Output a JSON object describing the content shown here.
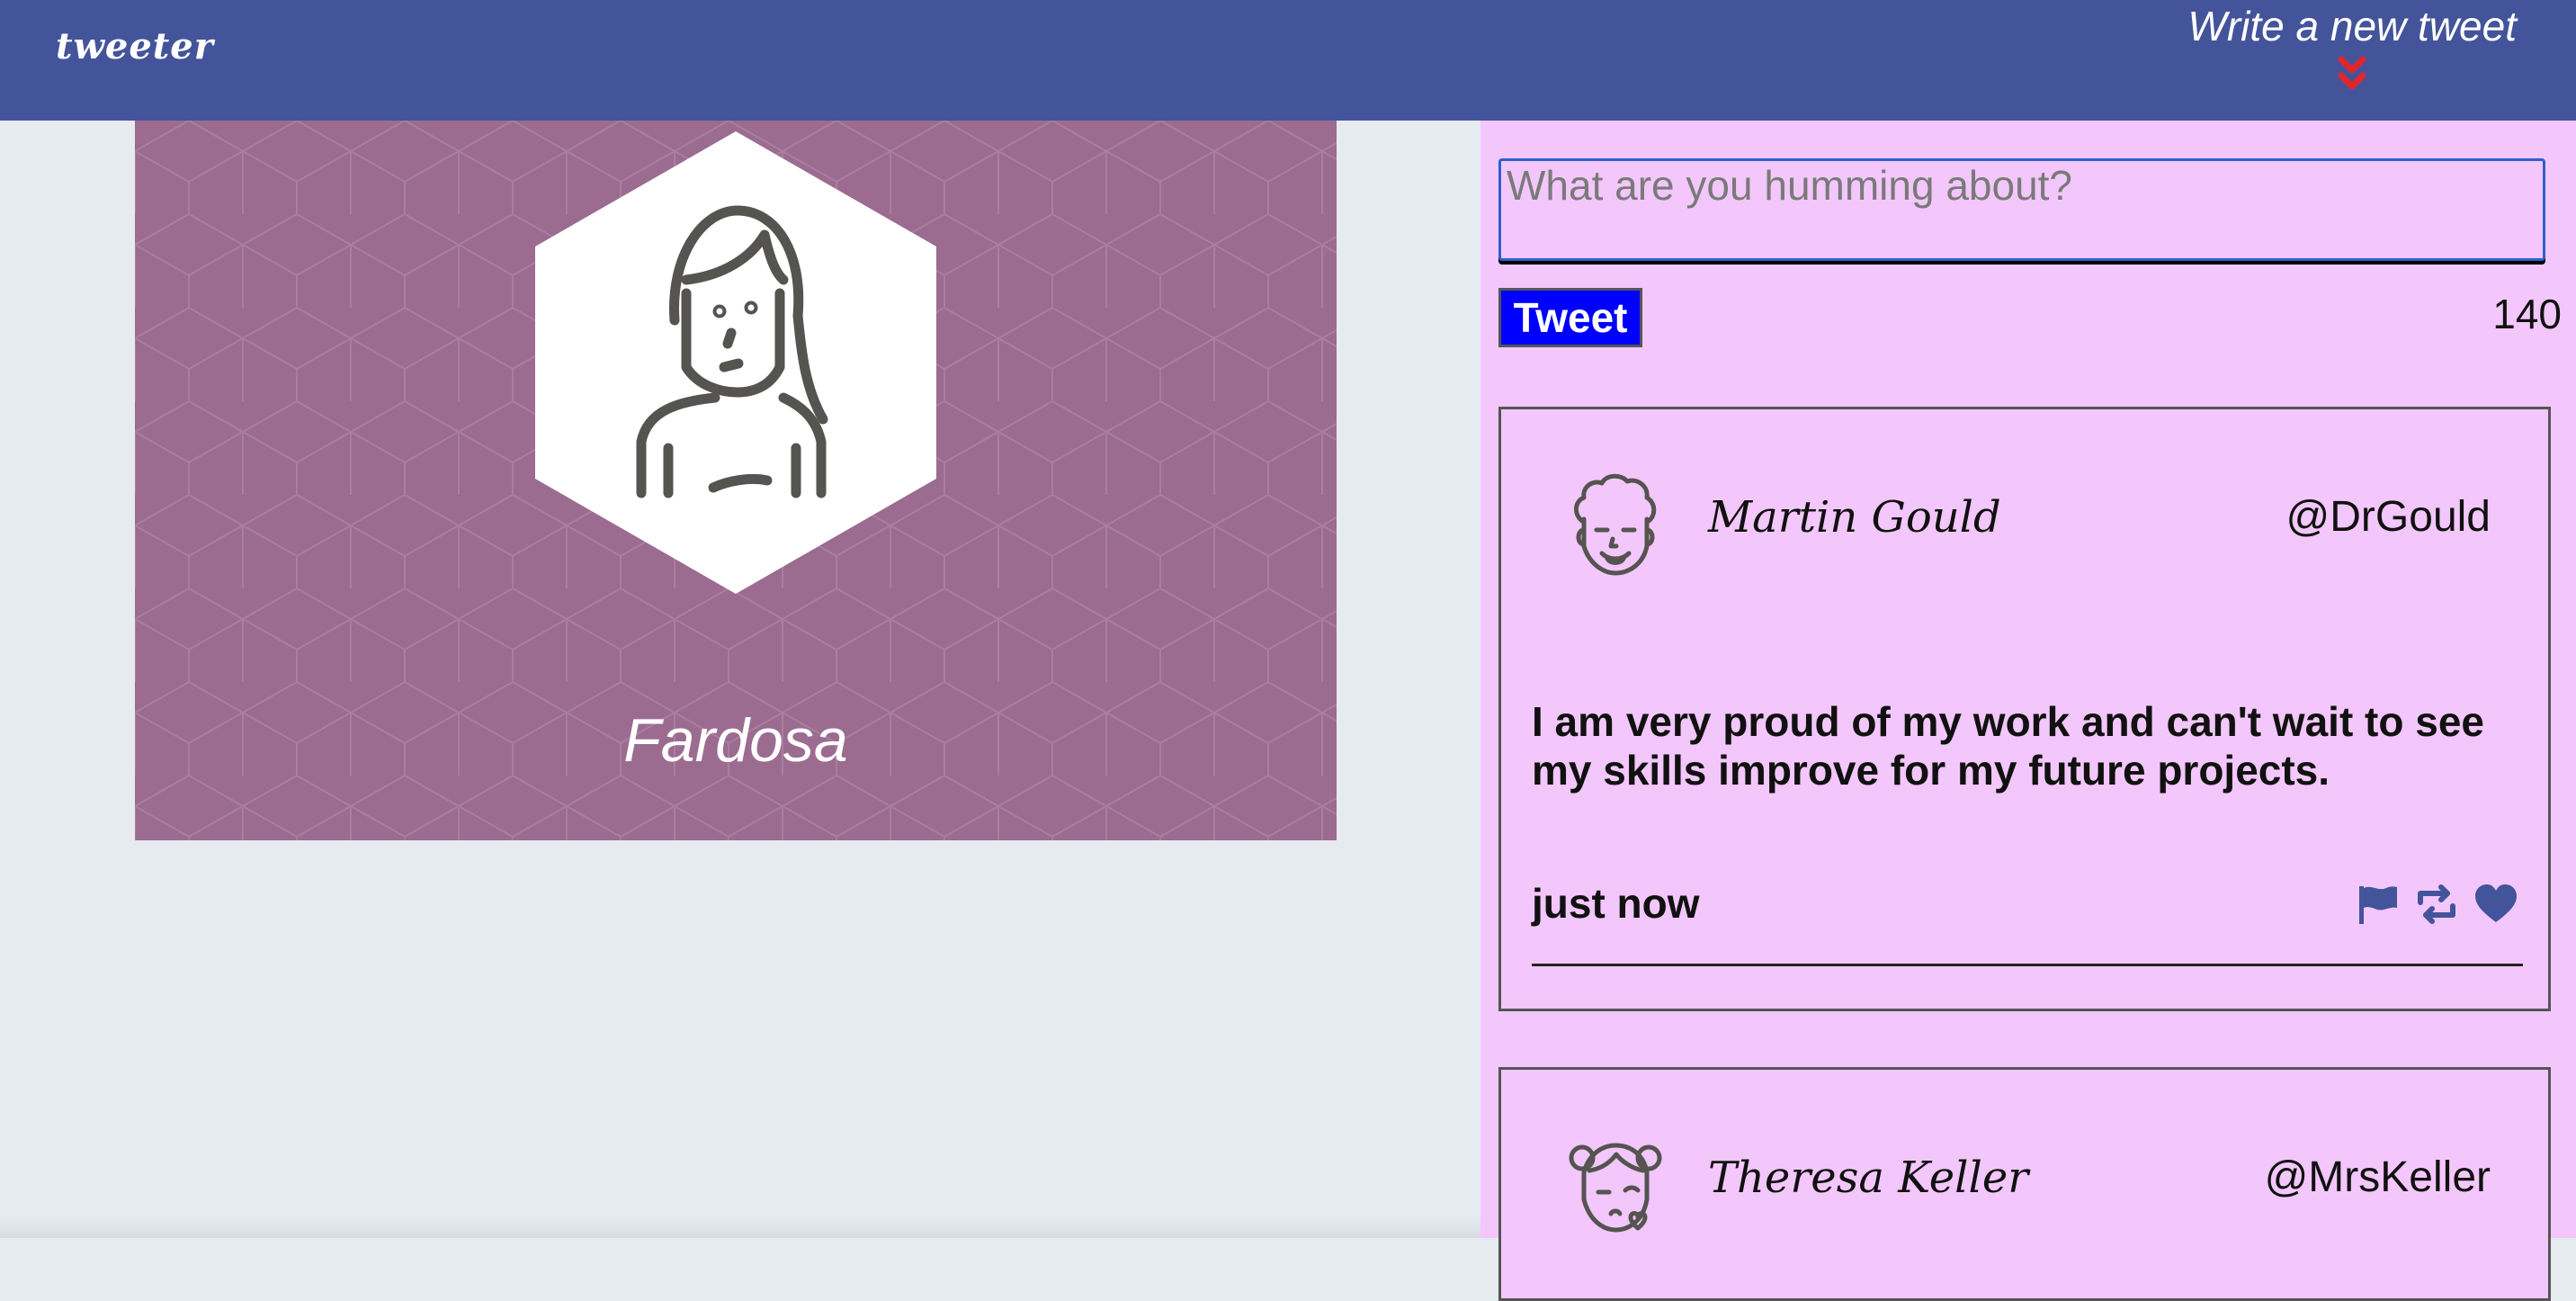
{
  "nav": {
    "brand": "tweeter",
    "write_prefix": "Write",
    "write_rest": " a new tweet",
    "chevron_icon": "double-chevron-down-icon",
    "chevron_color": "#e0262b",
    "background": "#44549a"
  },
  "profile": {
    "name": "Fardosa",
    "avatar_icon": "woman-avatar-icon",
    "background": "#9c6b90"
  },
  "compose": {
    "placeholder": "What are you humming about?",
    "button_label": "Tweet",
    "char_count": "140"
  },
  "tweets": [
    {
      "name": "Martin Gould",
      "handle": "@DrGould",
      "avatar_icon": "curly-hair-man-avatar-icon",
      "text": "I am very proud of my work and can't wait to see my skills improve for my future projects.",
      "time": "just now",
      "actions": [
        "flag-icon",
        "retweet-icon",
        "heart-icon"
      ]
    },
    {
      "name": "Theresa Keller",
      "handle": "@MrsKeller",
      "avatar_icon": "bun-hair-woman-avatar-icon"
    }
  ],
  "colors": {
    "page_bg": "#e6ebf0",
    "tweet_column_bg": "#f3c7fb",
    "tweet_button_bg": "#0000ff",
    "icon_color": "#44549a"
  }
}
